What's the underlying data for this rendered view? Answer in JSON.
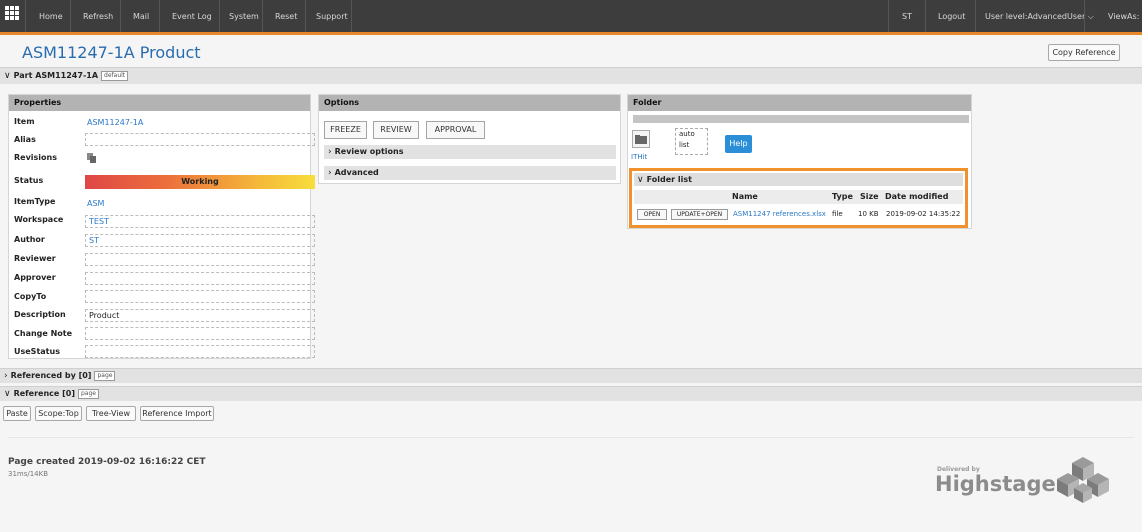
{
  "nav": {
    "items": [
      "Home",
      "Refresh",
      "Mail",
      "Event Log",
      "System",
      "Reset",
      "Support"
    ],
    "user": "ST",
    "logout": "Logout",
    "user_level": "User level:AdvancedUser",
    "view_as": "ViewAs:"
  },
  "page": {
    "title": "ASM11247-1A Product",
    "copy_reference": "Copy Reference",
    "part_section": "Part ASM11247-1A",
    "part_tag": "default"
  },
  "properties": {
    "header": "Properties",
    "item_label": "Item",
    "item_value": "ASM11247-1A",
    "alias_label": "Alias",
    "alias_value": "",
    "revisions_label": "Revisions",
    "status_label": "Status",
    "status_value": "Working",
    "itemtype_label": "ItemType",
    "itemtype_value": "ASM",
    "workspace_label": "Workspace",
    "workspace_value": "TEST",
    "author_label": "Author",
    "author_value": "ST",
    "reviewer_label": "Reviewer",
    "reviewer_value": "",
    "approver_label": "Approver",
    "approver_value": "",
    "copyto_label": "CopyTo",
    "copyto_value": "",
    "description_label": "Description",
    "description_value": "Product",
    "changenote_label": "Change Note",
    "changenote_value": "",
    "usestatus_label": "UseStatus",
    "usestatus_value": ""
  },
  "options": {
    "header": "Options",
    "buttons": [
      "FREEZE",
      "REVIEW",
      "APPROVAL"
    ],
    "review_options": "Review options",
    "advanced": "Advanced"
  },
  "folder": {
    "header": "Folder",
    "mode_line1": "auto",
    "mode_line2": "list",
    "help": "Help",
    "ithit": "ITHit",
    "list_title": "Folder list",
    "columns": [
      "Name",
      "Type",
      "Size",
      "Date modified"
    ],
    "row": {
      "open": "OPEN",
      "update_open": "UPDATE+OPEN",
      "name": "ASM11247 references.xlsx",
      "type": "file",
      "size": "10 KB",
      "date": "2019-09-02 14:35:22"
    }
  },
  "sections": {
    "referenced_by": "Referenced by [0]",
    "referenced_by_tag": "page",
    "reference": "Reference [0]",
    "reference_tag": "page"
  },
  "reference_buttons": [
    "Paste",
    "Scope:Top",
    "Tree-View",
    "Reference Import"
  ],
  "footer": {
    "page_created": "Page created 2019-09-02 16:16:22 CET",
    "timing": "31ms/14KB",
    "delivered_by": "Delivered by",
    "brand": "Highstage"
  },
  "colors": {
    "accent": "#e8882a",
    "link": "#2a78c8",
    "nav_bg": "#3d3d3d",
    "help_button": "#2a8fd6"
  },
  "icons": [
    "grid-menu-icon",
    "chevron-down-icon",
    "chevron-right-icon",
    "revisions-icon",
    "folder-icon",
    "highstage-cube-logo"
  ]
}
